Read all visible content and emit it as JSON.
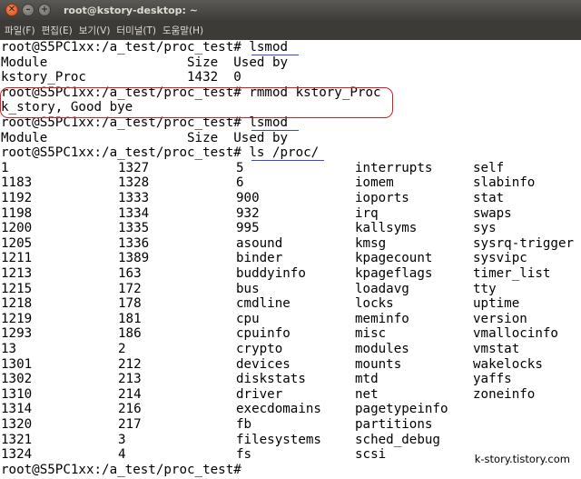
{
  "window": {
    "title": "root@kstory-desktop: ~",
    "buttons": {
      "close": "✕",
      "minimize": "–",
      "maximize": "+"
    }
  },
  "menubar": {
    "items": [
      "파일(F)",
      "편집(E)",
      "보기(V)",
      "터미널(T)",
      "도움말(H)"
    ]
  },
  "terminal": {
    "lines": [
      "root@S5PC1xx:/a_test/proc_test# lsmod",
      "Module                  Size  Used by",
      "kstory_Proc             1432  0",
      "root@S5PC1xx:/a_test/proc_test# rmmod kstory_Proc",
      "k_story, Good bye",
      "root@S5PC1xx:/a_test/proc_test# lsmod",
      "Module                  Size  Used by",
      "root@S5PC1xx:/a_test/proc_test# ls /proc/"
    ],
    "proc_columns": [
      [
        "1",
        "1183",
        "1192",
        "1198",
        "1200",
        "1205",
        "1211",
        "1213",
        "1215",
        "1218",
        "1219",
        "1293",
        "13",
        "1301",
        "1302",
        "1310",
        "1314",
        "1320",
        "1321",
        "1324"
      ],
      [
        "1327",
        "1328",
        "1333",
        "1334",
        "1335",
        "1336",
        "1389",
        "163",
        "172",
        "178",
        "181",
        "186",
        "2",
        "212",
        "213",
        "214",
        "216",
        "217",
        "3",
        "4"
      ],
      [
        "5",
        "6",
        "900",
        "932",
        "995",
        "asound",
        "binder",
        "buddyinfo",
        "bus",
        "cmdline",
        "cpu",
        "cpuinfo",
        "crypto",
        "devices",
        "diskstats",
        "driver",
        "execdomains",
        "fb",
        "filesystems",
        "fs"
      ],
      [
        "interrupts",
        "iomem",
        "ioports",
        "irq",
        "kallsyms",
        "kmsg",
        "kpagecount",
        "kpageflags",
        "loadavg",
        "locks",
        "meminfo",
        "misc",
        "modules",
        "mounts",
        "mtd",
        "net",
        "pagetypeinfo",
        "partitions",
        "sched_debug",
        "scsi"
      ],
      [
        "self",
        "slabinfo",
        "stat",
        "swaps",
        "sys",
        "sysrq-trigger",
        "sysvipc",
        "timer_list",
        "tty",
        "uptime",
        "version",
        "vmallocinfo",
        "vmstat",
        "wakelocks",
        "yaffs",
        "zoneinfo"
      ]
    ],
    "final_prompt": "root@S5PC1xx:/a_test/proc_test# "
  },
  "watermark": "k-story.tistory.com",
  "colors": {
    "titlebar": "#4b4a46",
    "menubar": "#3c3b37",
    "underline": "#3b48c8",
    "highlight_box": "#d22020"
  }
}
